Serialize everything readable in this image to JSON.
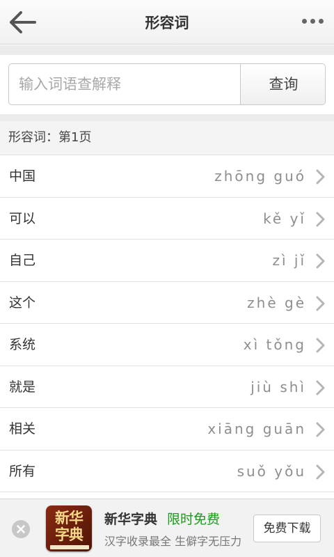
{
  "header": {
    "title": "形容词",
    "back_icon": "back-arrow-icon",
    "more_icon": "more-dots-icon"
  },
  "search": {
    "placeholder": "输入词语查解释",
    "value": "",
    "button_label": "查询"
  },
  "section": {
    "title": "形容词：第1页"
  },
  "list": {
    "items": [
      {
        "word": "中国",
        "pinyin": "zhōng guó"
      },
      {
        "word": "可以",
        "pinyin": "kě yǐ"
      },
      {
        "word": "自己",
        "pinyin": "zì jǐ"
      },
      {
        "word": "这个",
        "pinyin": "zhè gè"
      },
      {
        "word": "系统",
        "pinyin": "xì tǒng"
      },
      {
        "word": "就是",
        "pinyin": "jiù shì"
      },
      {
        "word": "相关",
        "pinyin": "xiāng guān"
      },
      {
        "word": "所有",
        "pinyin": "suǒ yǒu"
      }
    ]
  },
  "ad": {
    "logo_text": "新华字典",
    "title": "新华字典",
    "tag": "限时免费",
    "description": "汉字收录最全 生僻字无压力",
    "button_label": "免费下载",
    "colors": {
      "tag": "#1a9b1a",
      "logo": "#8a2b12"
    }
  }
}
